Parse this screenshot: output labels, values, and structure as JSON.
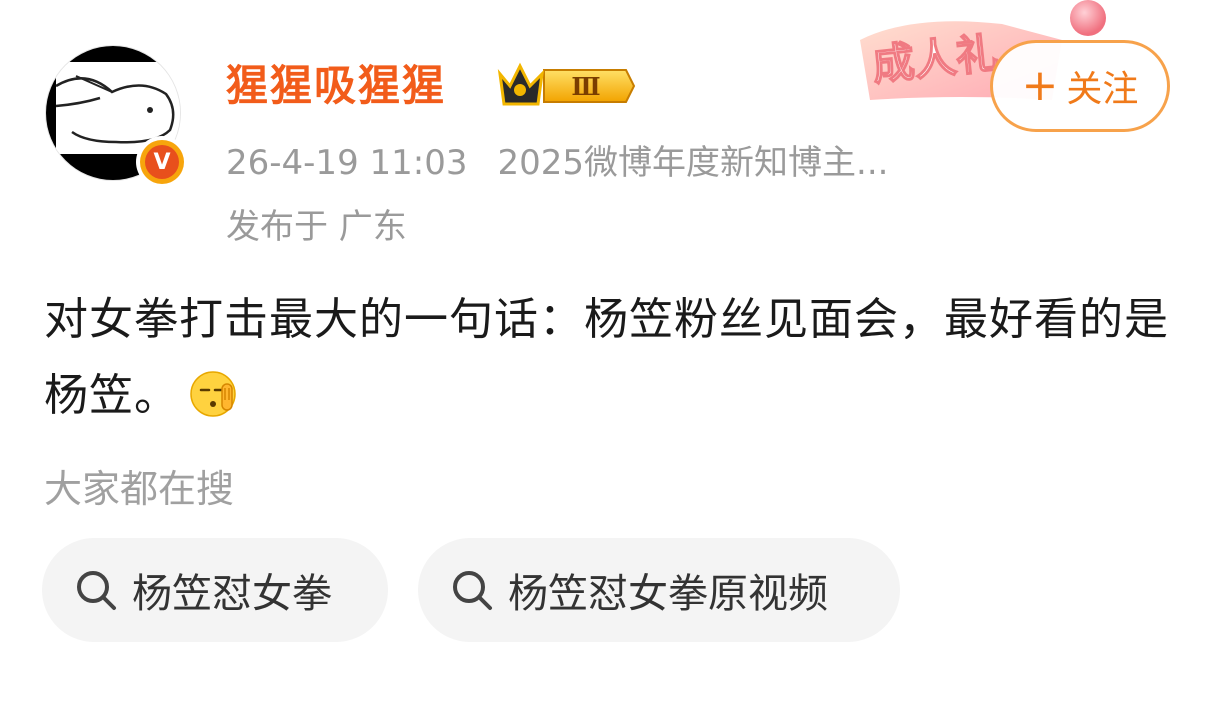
{
  "post": {
    "author": {
      "name": "猩猩吸猩猩",
      "level_badge": "Ⅲ"
    },
    "meta": {
      "time": "26-4-19 11:03",
      "honor": "2025微博年度新知博主...",
      "location": "发布于 广东"
    },
    "follow": {
      "label": "关注",
      "plus": "+"
    },
    "promo_text": "成人礼",
    "text": "对女拳打击最大的一句话：杨笠粉丝见面会，最好看的是杨笠。"
  },
  "search": {
    "title": "大家都在搜",
    "chips": [
      {
        "label": "杨笠怼女拳"
      },
      {
        "label": "杨笠怼女拳原视频"
      }
    ]
  },
  "colors": {
    "username": "#f25c1a",
    "follow_border": "#f7a24b",
    "meta": "#9a9a9a",
    "chip_bg": "#f4f4f4"
  }
}
